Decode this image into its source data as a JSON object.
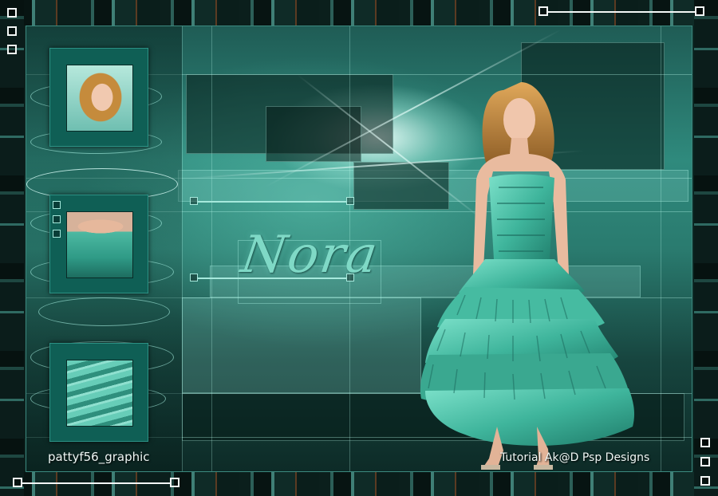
{
  "artwork": {
    "title": "Nora",
    "author_credit": "pattyf56_graphic",
    "tutorial_credit": "Tutorial Ak@D Psp Designs"
  },
  "thumbnails": [
    {
      "name": "thumbnail-face"
    },
    {
      "name": "thumbnail-bust"
    },
    {
      "name": "thumbnail-ruffles"
    }
  ],
  "colors": {
    "accent": "#2f8a7d",
    "highlight": "#7fd9c6",
    "frame": "#0f5f55",
    "dress": "#3fb59c"
  }
}
